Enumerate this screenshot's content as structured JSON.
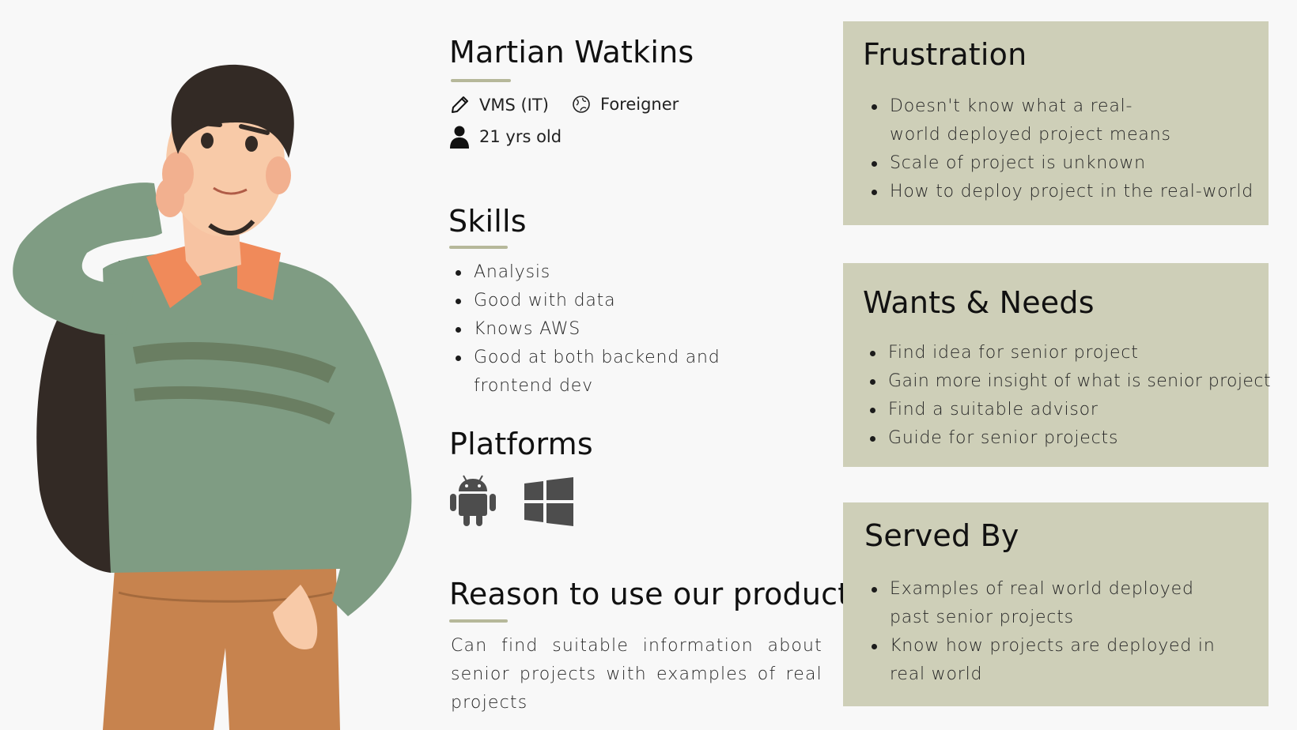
{
  "persona": {
    "name": "Martian Watkins",
    "major": "VMS (IT)",
    "nationality": "Foreigner",
    "age": "21 yrs old"
  },
  "skills": {
    "title": "Skills",
    "items": [
      "Analysis",
      "Good with data",
      "Knows AWS",
      "Good at both backend and frontend dev"
    ]
  },
  "platforms": {
    "title": "Platforms",
    "icons": [
      "android-icon",
      "windows-icon"
    ]
  },
  "reason": {
    "title": "Reason to use our product",
    "text": "Can find suitable information about senior projects with examples of real projects"
  },
  "frustration": {
    "title": "Frustration",
    "items": [
      "Doesn't know what a real-world deployed project means",
      "Scale of project is unknown",
      "How to deploy project in the real-world"
    ]
  },
  "wants": {
    "title": "Wants & Needs",
    "items": [
      "Find idea for senior project",
      "Gain more insight of what is senior project",
      "Find a suitable advisor",
      "Guide for senior projects"
    ]
  },
  "served": {
    "title": "Served By",
    "items": [
      "Examples of real world deployed past senior projects",
      "Know how projects are deployed in real world"
    ]
  },
  "colors": {
    "background": "#f8f8f8",
    "card": "#cecfb8",
    "accent_bar": "#b6b89a",
    "sweater": "#7f9c83",
    "collar": "#f08a5a",
    "pants": "#c7834e"
  }
}
